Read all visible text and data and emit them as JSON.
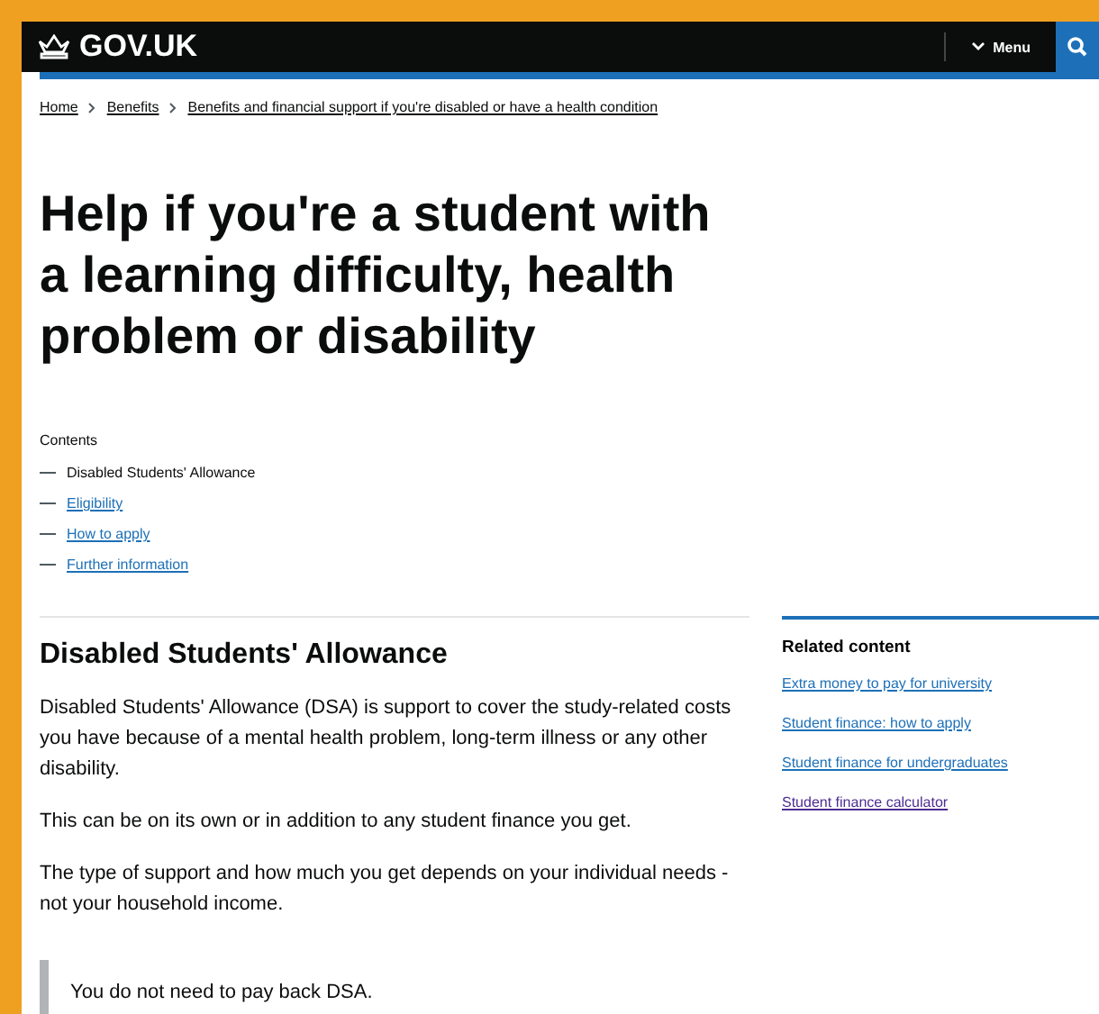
{
  "header": {
    "logo": "GOV.UK",
    "menu": "Menu"
  },
  "breadcrumbs": [
    {
      "label": "Home"
    },
    {
      "label": "Benefits"
    },
    {
      "label": "Benefits and financial support if you're disabled or have a health condition"
    }
  ],
  "title": "Help if you're a student with a learning difficulty, health problem or disability",
  "contents": {
    "heading": "Contents",
    "items": [
      {
        "label": "Disabled Students' Allowance",
        "current": true
      },
      {
        "label": "Eligibility",
        "current": false
      },
      {
        "label": "How to apply",
        "current": false
      },
      {
        "label": "Further information",
        "current": false
      }
    ]
  },
  "section": {
    "heading": "Disabled Students' Allowance",
    "paragraphs": [
      "Disabled Students' Allowance (DSA) is support to cover the study-related costs you have because of a mental health problem, long-term illness or any other disability.",
      "This can be on its own or in addition to any student finance you get.",
      "The type of support and how much you get depends on your individual needs - not your household income."
    ],
    "inset": "You do not need to pay back DSA."
  },
  "related": {
    "heading": "Related content",
    "links": [
      {
        "label": "Extra money to pay for university",
        "visited": false
      },
      {
        "label": "Student finance: how to apply",
        "visited": false
      },
      {
        "label": "Student finance for undergraduates",
        "visited": false
      },
      {
        "label": "Student finance calculator",
        "visited": true
      }
    ]
  }
}
